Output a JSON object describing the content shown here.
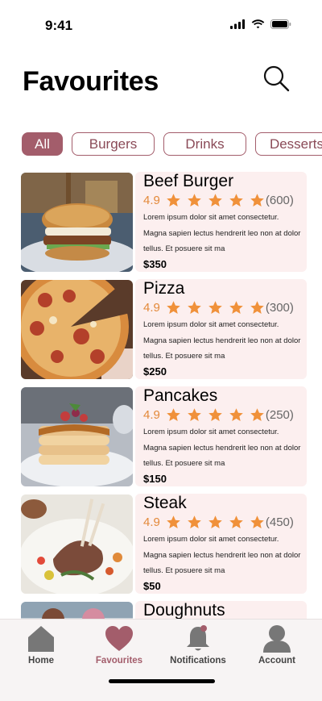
{
  "status": {
    "time": "9:41"
  },
  "header": {
    "title": "Favourites"
  },
  "filters": [
    {
      "label": "All",
      "active": true
    },
    {
      "label": "Burgers",
      "active": false
    },
    {
      "label": "Drinks",
      "active": false
    },
    {
      "label": "Desserts",
      "active": false
    }
  ],
  "items": [
    {
      "name": "Beef Burger",
      "rating": "4.9",
      "stars": 5,
      "reviews": "(600)",
      "description": "Lorem ipsum dolor sit amet consectetur. Magna sapien lectus hendrerit leo non at dolor tellus. Et posuere sit ma",
      "price": "$350"
    },
    {
      "name": "Pizza",
      "rating": "4.9",
      "stars": 5,
      "reviews": "(300)",
      "description": "Lorem ipsum dolor sit amet consectetur. Magna sapien lectus hendrerit leo non at dolor tellus. Et posuere sit ma",
      "price": "$250"
    },
    {
      "name": "Pancakes",
      "rating": "4.9",
      "stars": 5,
      "reviews": "(250)",
      "description": "Lorem ipsum dolor sit amet consectetur. Magna sapien lectus hendrerit leo non at dolor tellus. Et posuere sit ma",
      "price": "$150"
    },
    {
      "name": "Steak",
      "rating": "4.9",
      "stars": 5,
      "reviews": "(450)",
      "description": "Lorem ipsum dolor sit amet consectetur. Magna sapien lectus hendrerit leo non at dolor tellus. Et posuere sit ma",
      "price": "$50"
    },
    {
      "name": "Doughnuts"
    }
  ],
  "tabbar": {
    "tabs": [
      {
        "label": "Home",
        "icon": "home-icon"
      },
      {
        "label": "Favourites",
        "icon": "heart-icon",
        "active": true
      },
      {
        "label": "Notifications",
        "icon": "bell-icon"
      },
      {
        "label": "Account",
        "icon": "account-icon"
      }
    ]
  },
  "colors": {
    "accent": "#a35d6b",
    "star": "#f0913a",
    "card_bg": "#fcefef"
  }
}
